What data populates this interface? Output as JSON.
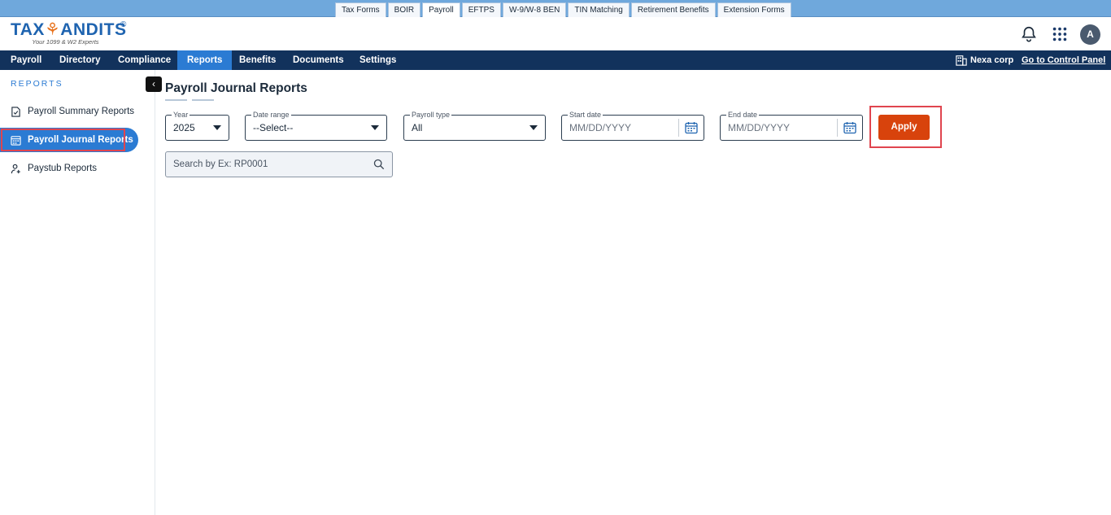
{
  "product_tabs": [
    "Tax Forms",
    "BOIR",
    "Payroll",
    "EFTPS",
    "W-9/W-8 BEN",
    "TIN Matching",
    "Retirement Benefits",
    "Extension Forms"
  ],
  "active_product": "Payroll",
  "logo": {
    "text_a": "TAX",
    "text_b": "ANDITS",
    "tagline": "Your 1099 & W2 Experts",
    "reg": "®"
  },
  "avatar_initial": "A",
  "nav": [
    "Payroll",
    "Directory",
    "Compliance",
    "Reports",
    "Benefits",
    "Documents",
    "Settings"
  ],
  "active_nav": "Reports",
  "company_name": "Nexa corp",
  "control_panel_label": "Go to Control Panel",
  "sidebar": {
    "heading": "REPORTS",
    "items": [
      "Payroll Summary Reports",
      "Payroll Journal Reports",
      "Paystub Reports"
    ],
    "active": "Payroll Journal Reports"
  },
  "page": {
    "title": "Payroll Journal Reports"
  },
  "filters": {
    "year": {
      "label": "Year",
      "value": "2025"
    },
    "date_range": {
      "label": "Date range",
      "value": "--Select--"
    },
    "payroll_type": {
      "label": "Payroll type",
      "value": "All"
    },
    "start_date": {
      "label": "Start date",
      "placeholder": "MM/DD/YYYY"
    },
    "end_date": {
      "label": "End date",
      "placeholder": "MM/DD/YYYY"
    },
    "apply_label": "Apply"
  },
  "search": {
    "placeholder": "Search by Ex: RP0001"
  },
  "colors": {
    "nav_bg": "#12325c",
    "accent": "#2b7bd3",
    "apply": "#d8430c",
    "highlight": "#e0454f"
  }
}
